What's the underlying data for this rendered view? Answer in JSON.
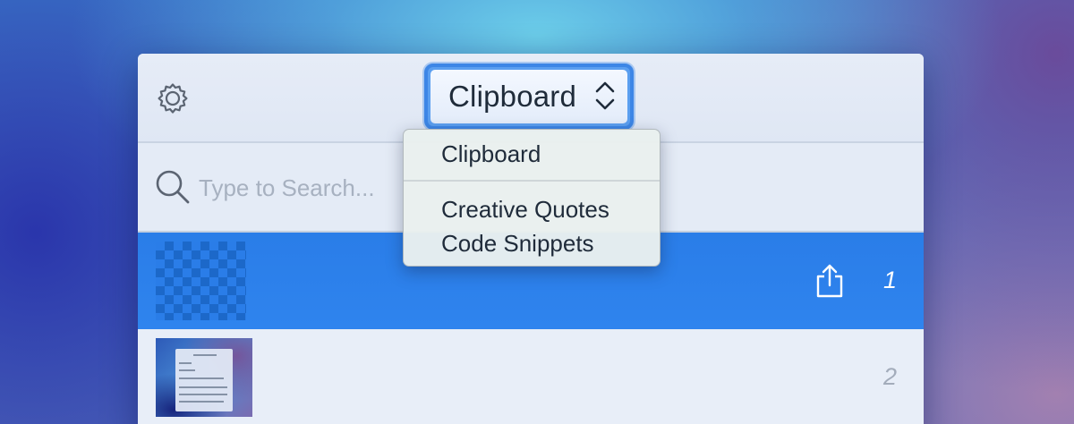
{
  "toolbar": {
    "settings_icon": "gear-icon",
    "selector": {
      "label": "Clipboard",
      "icon": "chevron-updown-icon",
      "focus_color": "#3d86e6"
    }
  },
  "search": {
    "icon": "search-icon",
    "placeholder": "Type to Search...",
    "value": ""
  },
  "dropdown_menu": {
    "items": [
      {
        "label": "Clipboard"
      },
      {
        "label": "Creative Quotes"
      },
      {
        "label": "Code Snippets"
      }
    ]
  },
  "clip_rows": [
    {
      "index": "1",
      "selected": true,
      "thumbnail": "transparent-image",
      "action_icon": "share-icon"
    },
    {
      "index": "2",
      "selected": false,
      "thumbnail": "screenshot-image"
    }
  ],
  "colors": {
    "selection": "#2a7de8",
    "text": "#1f2b3a",
    "placeholder": "#a7b1c0"
  }
}
